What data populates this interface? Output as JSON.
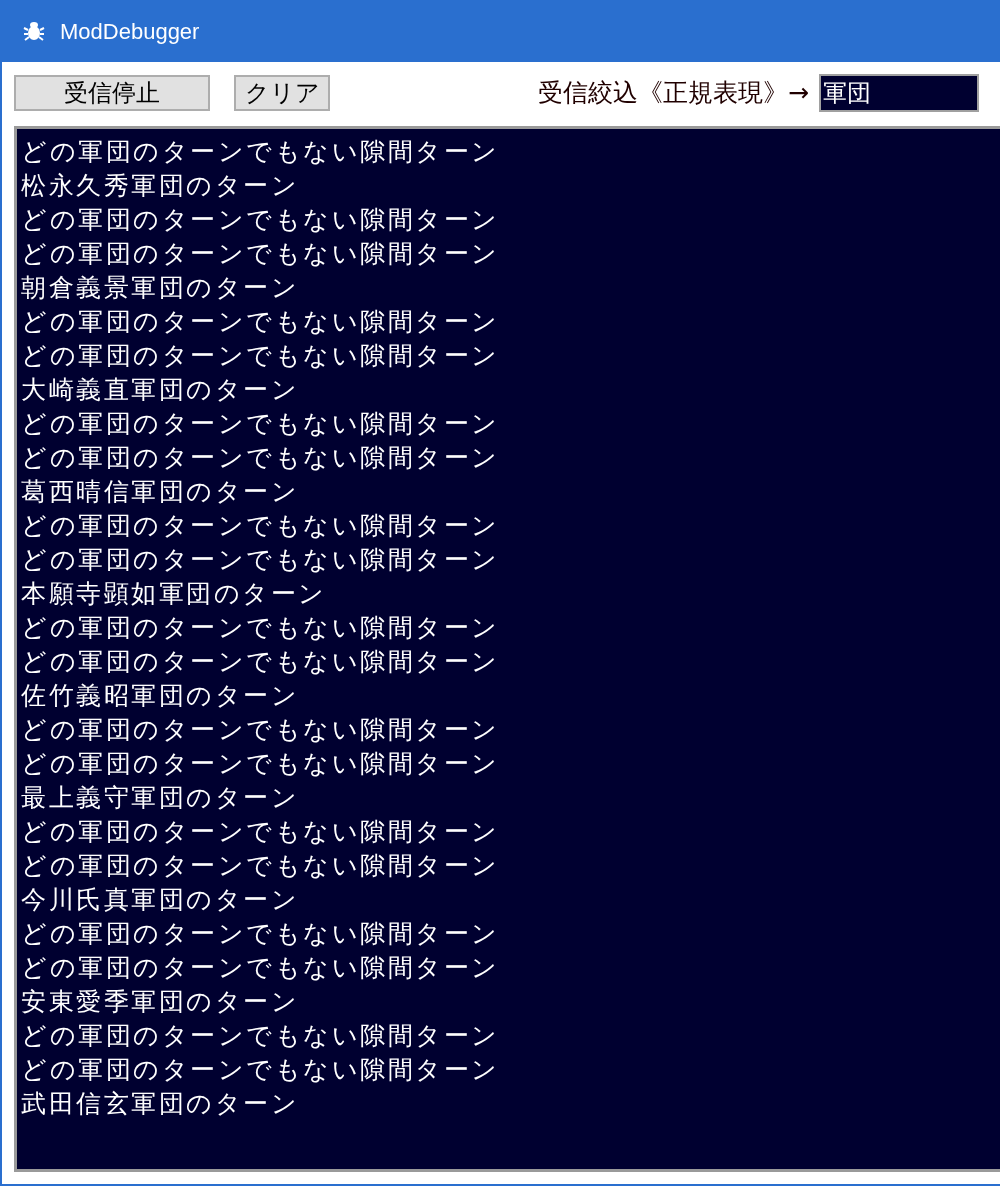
{
  "window": {
    "title": "ModDebugger"
  },
  "toolbar": {
    "buttons": [
      "受信停止",
      "クリア"
    ],
    "filter_label": "受信絞込《正規表現》→",
    "filter_value": "軍団"
  },
  "log": {
    "lines": [
      "どの軍団のターンでもない隙間ターン",
      "松永久秀軍団のターン",
      "どの軍団のターンでもない隙間ターン",
      "どの軍団のターンでもない隙間ターン",
      "朝倉義景軍団のターン",
      "どの軍団のターンでもない隙間ターン",
      "どの軍団のターンでもない隙間ターン",
      "大崎義直軍団のターン",
      "どの軍団のターンでもない隙間ターン",
      "どの軍団のターンでもない隙間ターン",
      "葛西晴信軍団のターン",
      "どの軍団のターンでもない隙間ターン",
      "どの軍団のターンでもない隙間ターン",
      "本願寺顕如軍団のターン",
      "どの軍団のターンでもない隙間ターン",
      "どの軍団のターンでもない隙間ターン",
      "佐竹義昭軍団のターン",
      "どの軍団のターンでもない隙間ターン",
      "どの軍団のターンでもない隙間ターン",
      "最上義守軍団のターン",
      "どの軍団のターンでもない隙間ターン",
      "どの軍団のターンでもない隙間ターン",
      "今川氏真軍団のターン",
      "どの軍団のターンでもない隙間ターン",
      "どの軍団のターンでもない隙間ターン",
      "安東愛季軍団のターン",
      "どの軍団のターンでもない隙間ターン",
      "どの軍団のターンでもない隙間ターン",
      "武田信玄軍団のターン"
    ]
  }
}
